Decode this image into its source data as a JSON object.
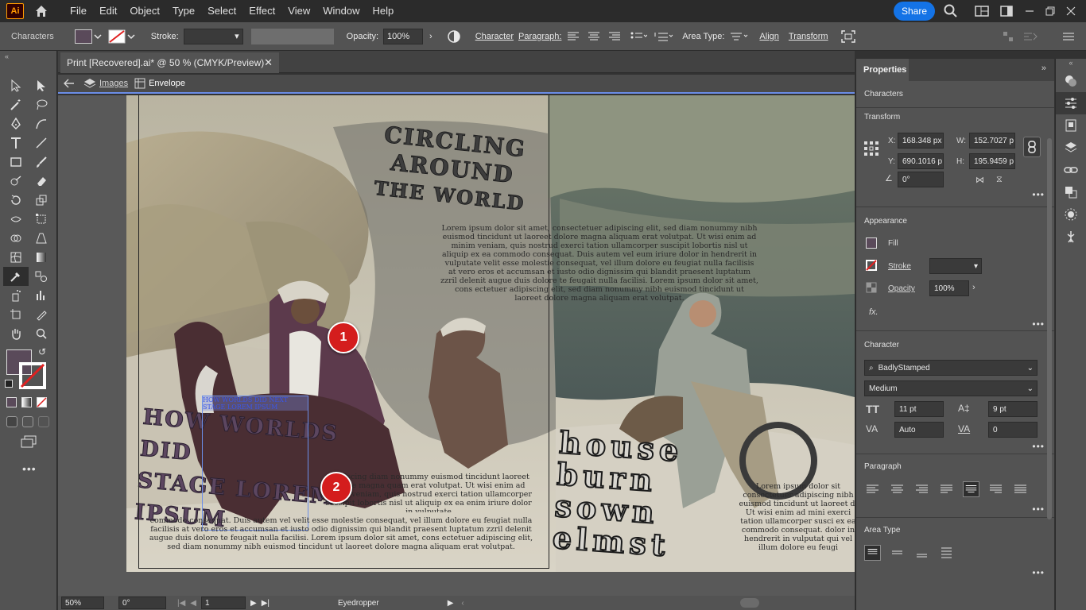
{
  "app": {
    "logo": "Ai",
    "share": "Share"
  },
  "menu": [
    "File",
    "Edit",
    "Object",
    "Type",
    "Select",
    "Effect",
    "View",
    "Window",
    "Help"
  ],
  "control": {
    "context": "Characters",
    "stroke_label": "Stroke:",
    "opacity_label": "Opacity:",
    "opacity_value": "100%",
    "character": "Character",
    "paragraph": "Paragraph:",
    "area_type": "Area Type:",
    "align": "Align",
    "transform": "Transform"
  },
  "document": {
    "tab": "Print [Recovered].ai* @ 50 % (CMYK/Preview)",
    "breadcrumb_1": "Images",
    "breadcrumb_2": "Envelope"
  },
  "status": {
    "zoom": "50%",
    "rotation": "0°",
    "artboard": "1",
    "tool": "Eyedropper"
  },
  "properties": {
    "tab": "Properties",
    "selection": "Characters",
    "transform": {
      "title": "Transform",
      "x_label": "X:",
      "x": "168.348 px",
      "y_label": "Y:",
      "y": "690.1016 p",
      "w_label": "W:",
      "w": "152.7027 p",
      "h_label": "H:",
      "h": "195.9459 p",
      "angle": "0°"
    },
    "appearance": {
      "title": "Appearance",
      "fill": "Fill",
      "stroke": "Stroke",
      "opacity": "Opacity",
      "opacity_value": "100%",
      "fx": "fx."
    },
    "character": {
      "title": "Character",
      "font": "BadlyStamped",
      "style": "Medium",
      "size": "11 pt",
      "leading": "9 pt",
      "kerning": "Auto",
      "tracking": "0"
    },
    "paragraph": {
      "title": "Paragraph"
    },
    "area_type": {
      "title": "Area Type"
    }
  },
  "artwork": {
    "title_top": [
      "CIRCLING",
      "AROUND",
      "THE WORLD"
    ],
    "title_left": [
      "HOW WORLDS DID",
      "STAGE LOREM IPSUM"
    ],
    "selected_text": [
      "HOW WORLDS DID NEXT",
      "STAGE LOREM IPSUM"
    ],
    "title_right": [
      "house",
      "burn",
      "sown",
      "elmst"
    ],
    "lorem_center": "Lorem ipsum dolor sit amet, consectetuer adipiscing elit, sed diam nonummy nibh euismod tincidunt ut laoreet dolore magna aliquam erat volutpat. Ut wisi enim ad minim veniam, quis nostrud exerci tation ullamcorper suscipit lobortis nisl ut aliquip ex ea commodo consequat. Duis autem vel eum iriure dolor in hendrerit in vulputate velit esse molestie consequat, vel illum dolore eu feugiat nulla facilisis at vero eros et accumsan et iusto odio dignissim qui blandit praesent luptatum zzril delenit augue duis dolore te feugait nulla facilisi. Lorem ipsum dolor sit amet, cons ectetuer adipiscing elit, sed diam nonummy nibh euismod tincidunt ut laoreet dolore magna aliquam erat volutpat.",
    "lorem_bottom": "commodo consequat. Duis autem vel velit esse molestie consequat, vel illum dolore eu feugiat nulla facilisis at vero eros et accumsan et iusto odio dignissim qui blandit praesent luptatum zzril delenit augue duis dolore te feugait nulla facilisi. Lorem ipsum dolor sit amet, cons ectetuer adipiscing elit, sed diam nonummy nibh euismod tincidunt ut laoreet dolore magna aliquam erat volutpat.",
    "lorem_mid": "adipiscing diam nonummy euismod tincidunt laoreet dolore magna quam erat volutpat. Ut wisi enim ad minim veniam, quis nostrud exerci tation ullamcorper suscipit lobortis nisl ut aliquip ex ea enim iriure dolor in vulputate",
    "lorem_right": "Lorem ipsum dolor sit consectetuer adipiscing nibh euismod tincidunt ut laoreet d. Ut wisi enim ad mini exerci tation ullamcorper susci ex ea commodo consequat. dolor in hendrerit in vulputat qui vel illum dolore eu feugi",
    "callout_1": "1",
    "callout_2": "2"
  },
  "colors": {
    "fill": "#5a4a5a",
    "accent": "#1473e6",
    "callout": "#d41d1d"
  }
}
